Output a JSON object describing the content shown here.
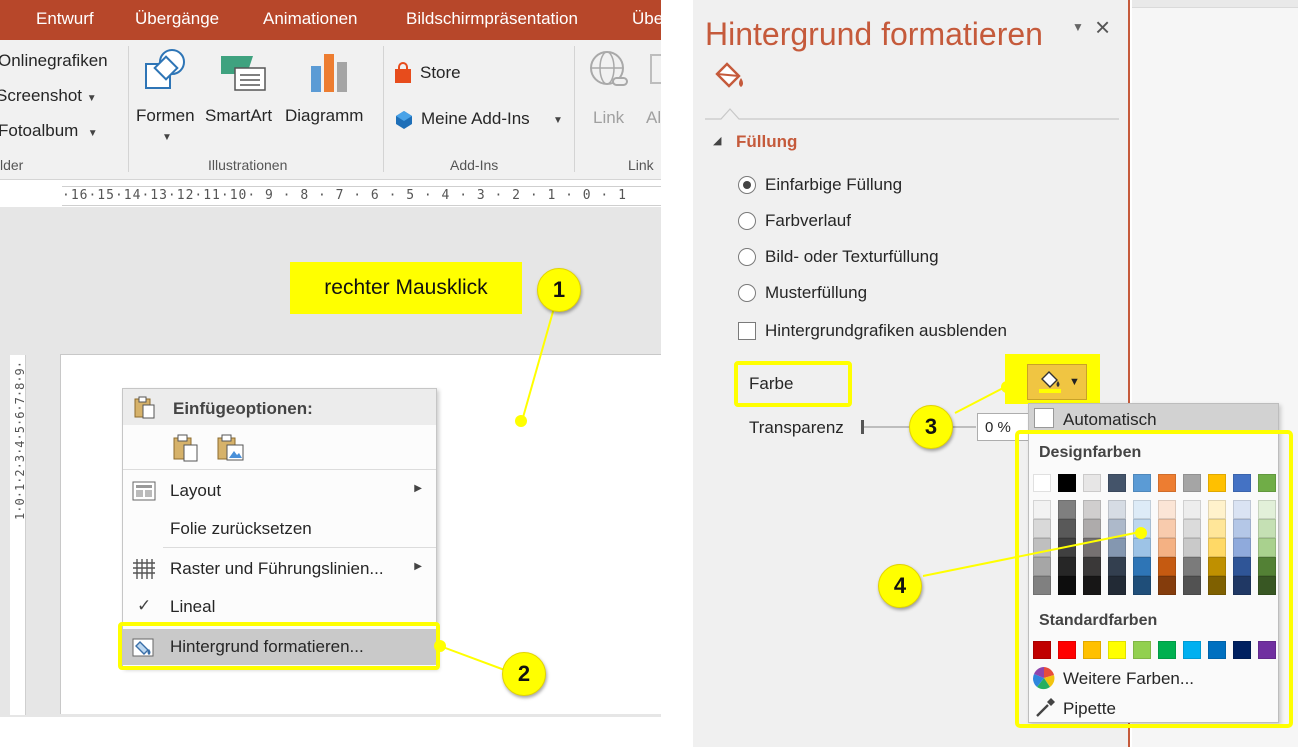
{
  "ribbon": {
    "tabs": [
      "Entwurf",
      "Übergänge",
      "Animationen",
      "Bildschirmpräsentation",
      "Übe"
    ],
    "images_group": {
      "items": [
        "Onlinegrafiken",
        "Screenshot",
        "Fotoalbum"
      ],
      "label": "lder"
    },
    "illustrations": {
      "buttons": [
        "Formen",
        "SmartArt",
        "Diagramm"
      ],
      "label": "Illustrationen"
    },
    "addins": {
      "buttons": [
        "Store",
        "Meine Add-Ins"
      ],
      "label": "Add-Ins"
    },
    "links": {
      "buttons": [
        "Link",
        "Al"
      ],
      "label": "Link"
    }
  },
  "ruler": {
    "horizontal": "·16·15·14·13·12·11·10· 9 · 8 · 7 · 6 · 5 · 4 · 3 · 2 · 1 · 0 · 1",
    "vertical": "1·0·1·2·3·4·5·6·7·8·9·"
  },
  "callouts": {
    "right_click_label": "rechter Mausklick",
    "badges": [
      "1",
      "2",
      "3",
      "4"
    ]
  },
  "context_menu": {
    "paste_header": "Einfügeoptionen:",
    "items": {
      "layout": "Layout",
      "reset_slide": "Folie zurücksetzen",
      "grid": "Raster und Führungslinien...",
      "ruler": "Lineal",
      "format_background": "Hintergrund formatieren..."
    }
  },
  "pane": {
    "title": "Hintergrund formatieren",
    "section": "Füllung",
    "fill_options": [
      "Einfarbige Füllung",
      "Farbverlauf",
      "Bild- oder Texturfüllung",
      "Musterfüllung"
    ],
    "selected_fill": "Einfarbige Füllung",
    "hide_graphics_label": "Hintergrundgrafiken ausblenden",
    "hide_graphics_checked": false,
    "color_label": "Farbe",
    "transparency_label": "Transparenz",
    "transparency_value": "0 %"
  },
  "color_picker": {
    "automatic": "Automatisch",
    "theme_header": "Designfarben",
    "standard_header": "Standardfarben",
    "more_colors": "Weitere Farben...",
    "eyedropper": "Pipette",
    "theme_top": [
      "#ffffff",
      "#000000",
      "#e7e6e6",
      "#44546a",
      "#5b9bd5",
      "#ed7d31",
      "#a5a5a5",
      "#ffc000",
      "#4472c4",
      "#70ad47"
    ],
    "theme_shades": [
      [
        "#f2f2f2",
        "#d9d9d9",
        "#bfbfbf",
        "#a6a6a6",
        "#808080"
      ],
      [
        "#7f7f7f",
        "#595959",
        "#404040",
        "#262626",
        "#0d0d0d"
      ],
      [
        "#d0cece",
        "#aeabab",
        "#767171",
        "#3a3838",
        "#171616"
      ],
      [
        "#d6dce4",
        "#adb9ca",
        "#8497b0",
        "#333f4f",
        "#222a35"
      ],
      [
        "#ddebf7",
        "#bdd7ee",
        "#9dc3e6",
        "#2e75b6",
        "#1f4e79"
      ],
      [
        "#fbe5d6",
        "#f8cbad",
        "#f4b183",
        "#c55a11",
        "#843c0c"
      ],
      [
        "#ededed",
        "#dbdbdb",
        "#c9c9c9",
        "#7b7b7b",
        "#525252"
      ],
      [
        "#fff2cc",
        "#ffe699",
        "#ffd966",
        "#bf9000",
        "#7f6000"
      ],
      [
        "#dae3f3",
        "#b4c7e7",
        "#8faadc",
        "#2f5597",
        "#203864"
      ],
      [
        "#e2f0d9",
        "#c5e0b4",
        "#a9d18e",
        "#538135",
        "#385723"
      ]
    ],
    "standard": [
      "#c00000",
      "#ff0000",
      "#ffc000",
      "#ffff00",
      "#92d050",
      "#00b050",
      "#00b0f0",
      "#0070c0",
      "#002060",
      "#7030a0"
    ]
  }
}
